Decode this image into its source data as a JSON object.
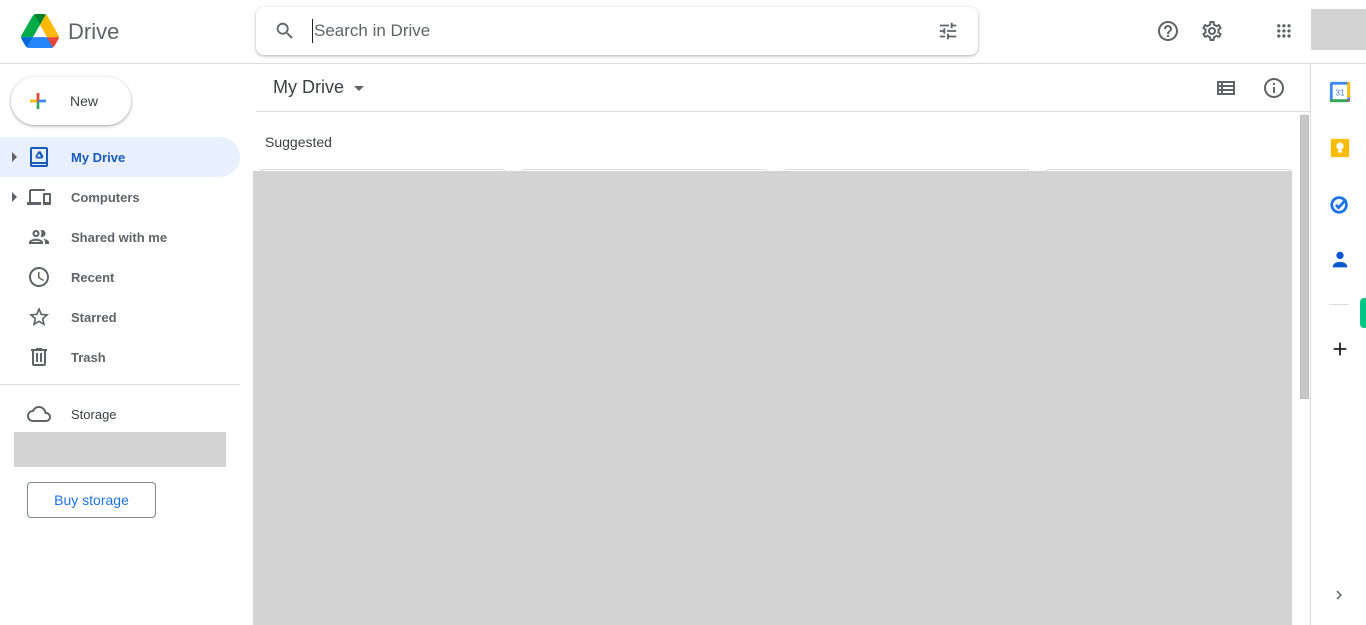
{
  "app": {
    "name": "Drive",
    "logo_icon": "google-drive-logo"
  },
  "search": {
    "placeholder": "Search in Drive",
    "value": "",
    "icon": "search-icon",
    "options_icon": "tune-icon"
  },
  "topbar": {
    "icons": [
      "help-icon",
      "settings-icon",
      "apps-grid-icon"
    ],
    "avatar": "account-avatar"
  },
  "sidebar": {
    "new_button": "New",
    "items": [
      {
        "label": "My Drive",
        "icon": "my-drive-icon",
        "expandable": true,
        "active": true
      },
      {
        "label": "Computers",
        "icon": "computers-icon",
        "expandable": true,
        "active": false
      },
      {
        "label": "Shared with me",
        "icon": "shared-icon",
        "expandable": false,
        "active": false
      },
      {
        "label": "Recent",
        "icon": "clock-icon",
        "expandable": false,
        "active": false
      },
      {
        "label": "Starred",
        "icon": "star-icon",
        "expandable": false,
        "active": false
      },
      {
        "label": "Trash",
        "icon": "trash-icon",
        "expandable": false,
        "active": false
      }
    ],
    "storage": {
      "label": "Storage",
      "icon": "cloud-icon"
    },
    "buy_storage": "Buy storage"
  },
  "main": {
    "breadcrumb": "My Drive",
    "view_icons": [
      "list-view-icon",
      "info-icon"
    ],
    "section_title": "Suggested"
  },
  "right_panel": {
    "apps": [
      "calendar-icon",
      "keep-icon",
      "tasks-icon",
      "contacts-icon"
    ],
    "calendar_day": "31",
    "add_label": "+",
    "expand_icon": "chevron-right-icon"
  },
  "colors": {
    "accent": "#1a73e8",
    "active_bg": "#e8f0fe",
    "active_text": "#185abc",
    "placeholder_gray": "#d3d3d3",
    "side_panel_indicator": "#00c785"
  }
}
